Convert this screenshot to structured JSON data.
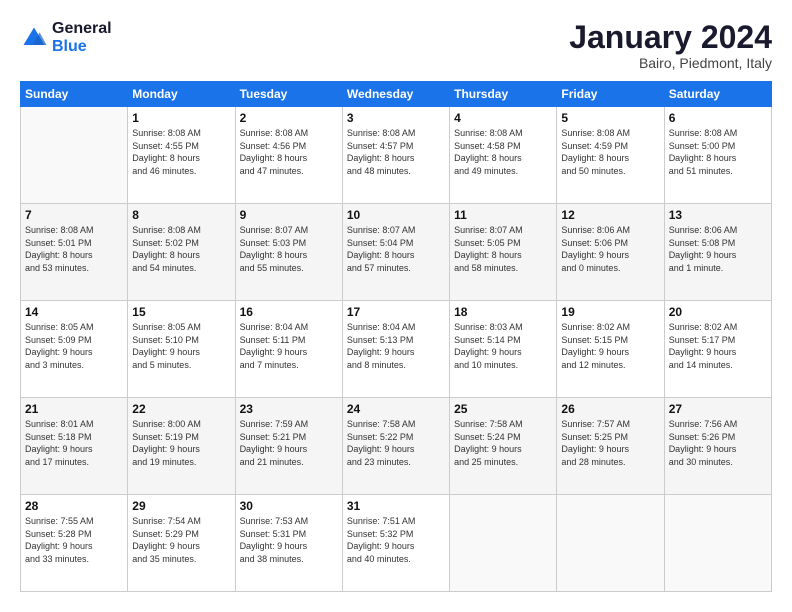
{
  "logo": {
    "line1": "General",
    "line2": "Blue"
  },
  "title": "January 2024",
  "subtitle": "Bairo, Piedmont, Italy",
  "weekdays": [
    "Sunday",
    "Monday",
    "Tuesday",
    "Wednesday",
    "Thursday",
    "Friday",
    "Saturday"
  ],
  "weeks": [
    [
      {
        "day": "",
        "info": ""
      },
      {
        "day": "1",
        "info": "Sunrise: 8:08 AM\nSunset: 4:55 PM\nDaylight: 8 hours\nand 46 minutes."
      },
      {
        "day": "2",
        "info": "Sunrise: 8:08 AM\nSunset: 4:56 PM\nDaylight: 8 hours\nand 47 minutes."
      },
      {
        "day": "3",
        "info": "Sunrise: 8:08 AM\nSunset: 4:57 PM\nDaylight: 8 hours\nand 48 minutes."
      },
      {
        "day": "4",
        "info": "Sunrise: 8:08 AM\nSunset: 4:58 PM\nDaylight: 8 hours\nand 49 minutes."
      },
      {
        "day": "5",
        "info": "Sunrise: 8:08 AM\nSunset: 4:59 PM\nDaylight: 8 hours\nand 50 minutes."
      },
      {
        "day": "6",
        "info": "Sunrise: 8:08 AM\nSunset: 5:00 PM\nDaylight: 8 hours\nand 51 minutes."
      }
    ],
    [
      {
        "day": "7",
        "info": "Sunrise: 8:08 AM\nSunset: 5:01 PM\nDaylight: 8 hours\nand 53 minutes."
      },
      {
        "day": "8",
        "info": "Sunrise: 8:08 AM\nSunset: 5:02 PM\nDaylight: 8 hours\nand 54 minutes."
      },
      {
        "day": "9",
        "info": "Sunrise: 8:07 AM\nSunset: 5:03 PM\nDaylight: 8 hours\nand 55 minutes."
      },
      {
        "day": "10",
        "info": "Sunrise: 8:07 AM\nSunset: 5:04 PM\nDaylight: 8 hours\nand 57 minutes."
      },
      {
        "day": "11",
        "info": "Sunrise: 8:07 AM\nSunset: 5:05 PM\nDaylight: 8 hours\nand 58 minutes."
      },
      {
        "day": "12",
        "info": "Sunrise: 8:06 AM\nSunset: 5:06 PM\nDaylight: 9 hours\nand 0 minutes."
      },
      {
        "day": "13",
        "info": "Sunrise: 8:06 AM\nSunset: 5:08 PM\nDaylight: 9 hours\nand 1 minute."
      }
    ],
    [
      {
        "day": "14",
        "info": "Sunrise: 8:05 AM\nSunset: 5:09 PM\nDaylight: 9 hours\nand 3 minutes."
      },
      {
        "day": "15",
        "info": "Sunrise: 8:05 AM\nSunset: 5:10 PM\nDaylight: 9 hours\nand 5 minutes."
      },
      {
        "day": "16",
        "info": "Sunrise: 8:04 AM\nSunset: 5:11 PM\nDaylight: 9 hours\nand 7 minutes."
      },
      {
        "day": "17",
        "info": "Sunrise: 8:04 AM\nSunset: 5:13 PM\nDaylight: 9 hours\nand 8 minutes."
      },
      {
        "day": "18",
        "info": "Sunrise: 8:03 AM\nSunset: 5:14 PM\nDaylight: 9 hours\nand 10 minutes."
      },
      {
        "day": "19",
        "info": "Sunrise: 8:02 AM\nSunset: 5:15 PM\nDaylight: 9 hours\nand 12 minutes."
      },
      {
        "day": "20",
        "info": "Sunrise: 8:02 AM\nSunset: 5:17 PM\nDaylight: 9 hours\nand 14 minutes."
      }
    ],
    [
      {
        "day": "21",
        "info": "Sunrise: 8:01 AM\nSunset: 5:18 PM\nDaylight: 9 hours\nand 17 minutes."
      },
      {
        "day": "22",
        "info": "Sunrise: 8:00 AM\nSunset: 5:19 PM\nDaylight: 9 hours\nand 19 minutes."
      },
      {
        "day": "23",
        "info": "Sunrise: 7:59 AM\nSunset: 5:21 PM\nDaylight: 9 hours\nand 21 minutes."
      },
      {
        "day": "24",
        "info": "Sunrise: 7:58 AM\nSunset: 5:22 PM\nDaylight: 9 hours\nand 23 minutes."
      },
      {
        "day": "25",
        "info": "Sunrise: 7:58 AM\nSunset: 5:24 PM\nDaylight: 9 hours\nand 25 minutes."
      },
      {
        "day": "26",
        "info": "Sunrise: 7:57 AM\nSunset: 5:25 PM\nDaylight: 9 hours\nand 28 minutes."
      },
      {
        "day": "27",
        "info": "Sunrise: 7:56 AM\nSunset: 5:26 PM\nDaylight: 9 hours\nand 30 minutes."
      }
    ],
    [
      {
        "day": "28",
        "info": "Sunrise: 7:55 AM\nSunset: 5:28 PM\nDaylight: 9 hours\nand 33 minutes."
      },
      {
        "day": "29",
        "info": "Sunrise: 7:54 AM\nSunset: 5:29 PM\nDaylight: 9 hours\nand 35 minutes."
      },
      {
        "day": "30",
        "info": "Sunrise: 7:53 AM\nSunset: 5:31 PM\nDaylight: 9 hours\nand 38 minutes."
      },
      {
        "day": "31",
        "info": "Sunrise: 7:51 AM\nSunset: 5:32 PM\nDaylight: 9 hours\nand 40 minutes."
      },
      {
        "day": "",
        "info": ""
      },
      {
        "day": "",
        "info": ""
      },
      {
        "day": "",
        "info": ""
      }
    ]
  ]
}
